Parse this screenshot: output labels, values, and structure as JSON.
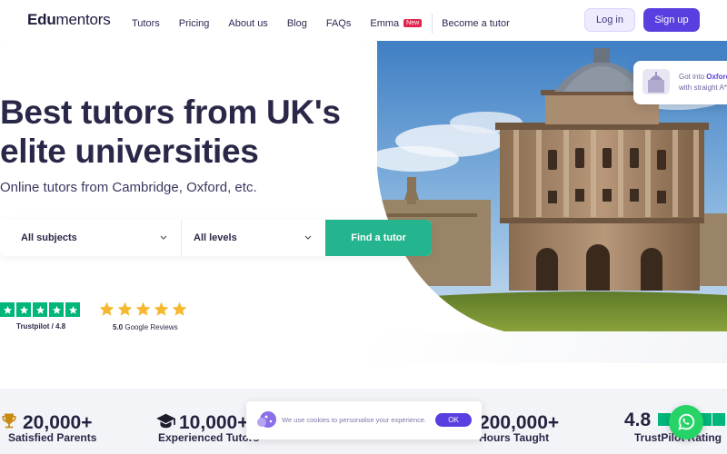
{
  "nav": {
    "logo_bold": "Edu",
    "logo_rest": "mentors",
    "links": [
      "Tutors",
      "Pricing",
      "About us",
      "Blog",
      "FAQs",
      "Emma"
    ],
    "new_badge": "New",
    "become_tutor": "Become a tutor",
    "login": "Log in",
    "signup": "Sign up"
  },
  "hero": {
    "title": "Best tutors from UK's elite universities",
    "subtitle": "Online tutors from Cambridge, Oxford, etc.",
    "search": {
      "subjects": "All subjects",
      "levels": "All levels",
      "button": "Find a tutor"
    },
    "trustpilot_label": "Trustpilot / 4.8",
    "google_rating": "5.0",
    "google_label": "Google Reviews"
  },
  "notification": {
    "line1_prefix": "Got into ",
    "line1_highlight": "Oxford",
    "line2": "with straight A*"
  },
  "stats": [
    {
      "number": "20,000+",
      "label": "Satisfied Parents",
      "icon": "trophy-icon"
    },
    {
      "number": "10,000+",
      "label": "Experienced Tutors",
      "icon": "graduation-cap-icon"
    },
    {
      "number": "200,000+",
      "label": "Hours Taught"
    },
    {
      "number": "4.8",
      "label": "TrustPilot Rating"
    }
  ],
  "cookie": {
    "text": "We use cookies to personalise your experience.",
    "ok": "OK"
  },
  "colors": {
    "brand_purple": "#5a3fe0",
    "find_green": "#24b58e",
    "trustpilot_green": "#00b67a",
    "google_star": "#f5b82e",
    "new_badge": "#e0264f",
    "whatsapp": "#25d366"
  }
}
